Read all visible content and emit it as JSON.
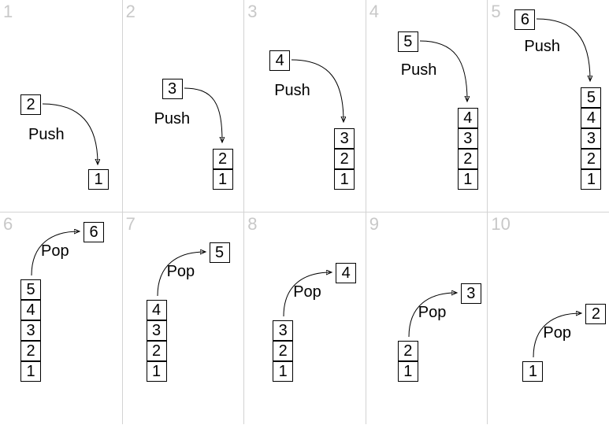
{
  "steps": [
    {
      "num": "1",
      "op": "Push",
      "pushVal": "2",
      "stack": [
        "1"
      ],
      "mode": "push-high"
    },
    {
      "num": "2",
      "op": "Push",
      "pushVal": "3",
      "stack": [
        "1",
        "2"
      ],
      "mode": "push-high"
    },
    {
      "num": "3",
      "op": "Push",
      "pushVal": "4",
      "stack": [
        "1",
        "2",
        "3"
      ],
      "mode": "push-med"
    },
    {
      "num": "4",
      "op": "Push",
      "pushVal": "5",
      "stack": [
        "1",
        "2",
        "3",
        "4"
      ],
      "mode": "push-low"
    },
    {
      "num": "5",
      "op": "Push",
      "pushVal": "6",
      "stack": [
        "1",
        "2",
        "3",
        "4",
        "5"
      ],
      "mode": "push-lowest"
    },
    {
      "num": "6",
      "op": "Pop",
      "popVal": "6",
      "stack": [
        "1",
        "2",
        "3",
        "4",
        "5"
      ],
      "mode": "pop"
    },
    {
      "num": "7",
      "op": "Pop",
      "popVal": "5",
      "stack": [
        "1",
        "2",
        "3",
        "4"
      ],
      "mode": "pop"
    },
    {
      "num": "8",
      "op": "Pop",
      "popVal": "4",
      "stack": [
        "1",
        "2",
        "3"
      ],
      "mode": "pop"
    },
    {
      "num": "9",
      "op": "Pop",
      "popVal": "3",
      "stack": [
        "1",
        "2"
      ],
      "mode": "pop"
    },
    {
      "num": "10",
      "op": "Pop",
      "popVal": "2",
      "stack": [
        "1"
      ],
      "mode": "pop"
    }
  ]
}
